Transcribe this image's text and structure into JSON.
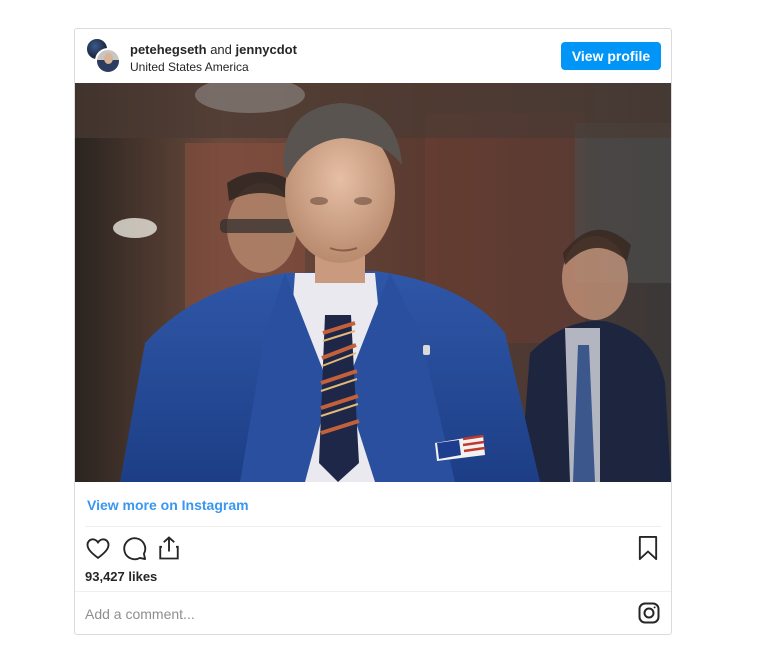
{
  "post": {
    "user_primary": "petehegseth",
    "and_text": "and",
    "user_secondary": "jennycdot",
    "location": "United States America",
    "view_profile_label": "View profile",
    "photo_alt": "petehegseth post photo",
    "view_more_label": "View more on Instagram",
    "likes_text": "93,427 likes",
    "comment_placeholder": "Add a comment..."
  },
  "icons": {
    "like": "heart-icon",
    "comment": "speech-bubble-icon",
    "share": "share-icon",
    "save": "bookmark-icon",
    "instagram": "instagram-logo-icon"
  },
  "colors": {
    "accent": "#0095f6",
    "link": "#3897f0",
    "text": "#262626",
    "muted": "#8e8e8e"
  }
}
